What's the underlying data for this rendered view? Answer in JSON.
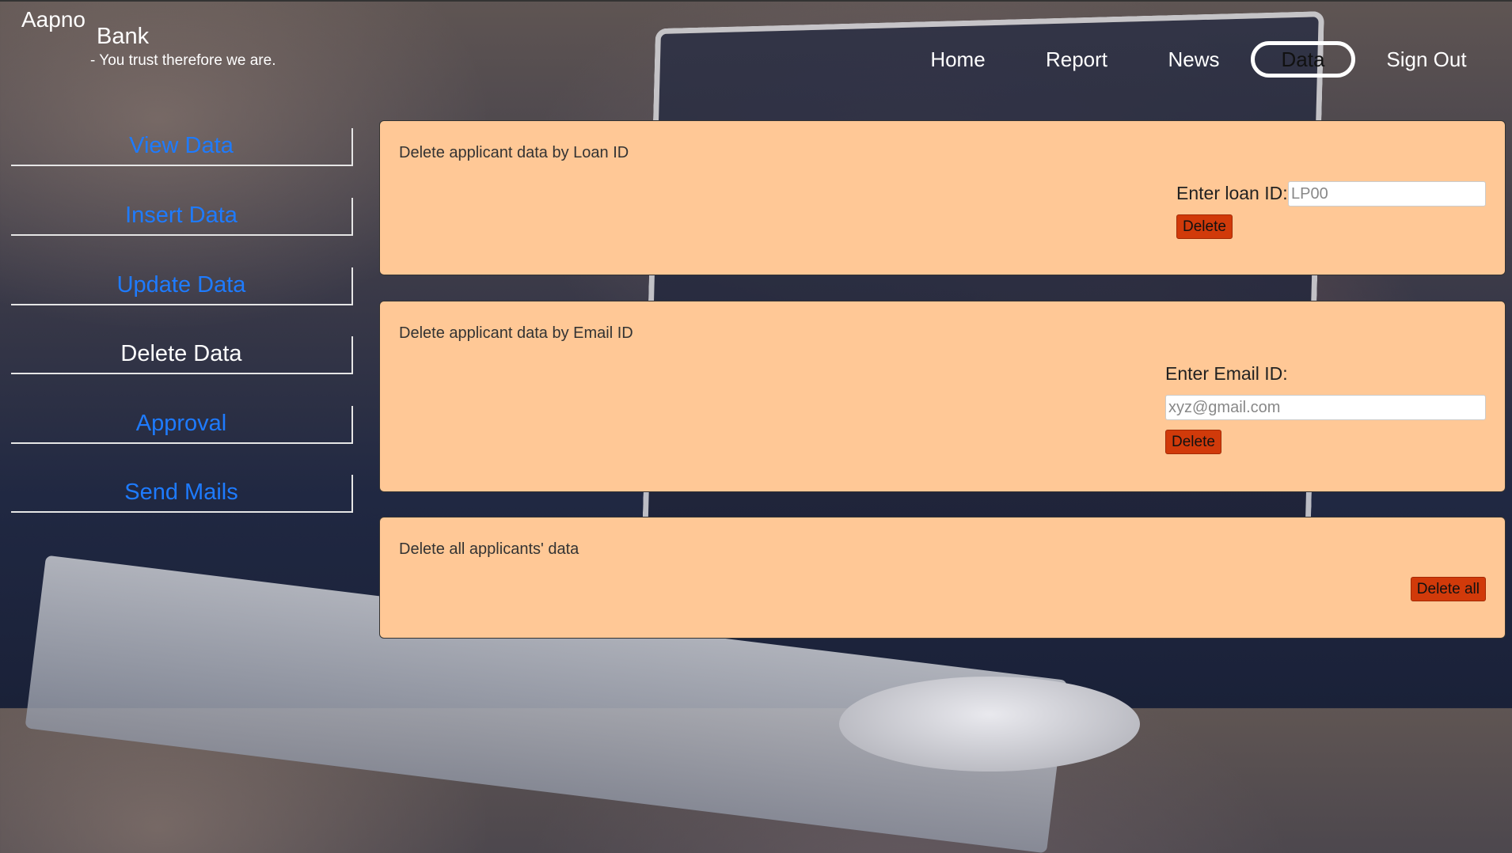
{
  "brand": {
    "name_part1": "Aapno",
    "name_part2": "Bank",
    "tagline": "- You trust therefore we are."
  },
  "nav": {
    "items": [
      {
        "label": "Home"
      },
      {
        "label": "Report"
      },
      {
        "label": "News"
      },
      {
        "label": "Data",
        "active": true
      },
      {
        "label": "Sign Out"
      }
    ]
  },
  "sidebar": {
    "items": [
      {
        "label": "View Data"
      },
      {
        "label": "Insert Data"
      },
      {
        "label": "Update Data"
      },
      {
        "label": "Delete Data",
        "active": true
      },
      {
        "label": "Approval"
      },
      {
        "label": "Send Mails"
      }
    ]
  },
  "panels": {
    "by_loan": {
      "title": "Delete applicant data by Loan ID",
      "field_label": "Enter loan ID:",
      "placeholder": "LP00",
      "button": "Delete"
    },
    "by_email": {
      "title": "Delete applicant data by Email ID",
      "field_label": "Enter Email ID:",
      "placeholder": "xyz@gmail.com",
      "button": "Delete"
    },
    "all": {
      "title": "Delete all applicants' data",
      "button": "Delete all"
    }
  },
  "colors": {
    "panel_bg": "#ffc896",
    "button_bg": "#d13a0a",
    "sidebar_link": "#1e7bff"
  }
}
